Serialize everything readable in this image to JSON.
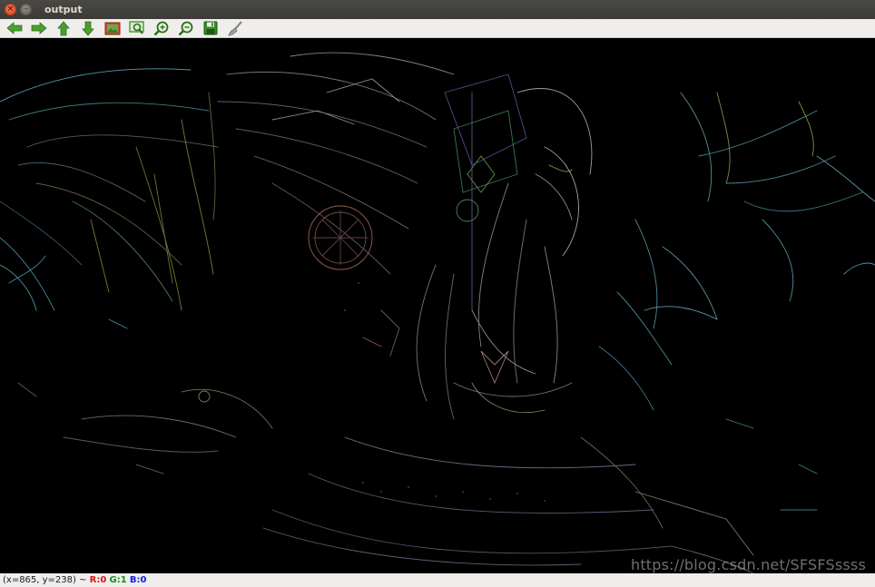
{
  "window": {
    "title": "output",
    "close_glyph": "×",
    "minimize_glyph": "–"
  },
  "toolbar": {
    "buttons": [
      {
        "name": "pan-left-button",
        "icon": "arrow-left-icon",
        "color": "#4aa02c"
      },
      {
        "name": "pan-right-button",
        "icon": "arrow-right-icon",
        "color": "#4aa02c"
      },
      {
        "name": "pan-up-button",
        "icon": "arrow-up-icon",
        "color": "#4aa02c"
      },
      {
        "name": "pan-down-button",
        "icon": "arrow-down-icon",
        "color": "#4aa02c"
      },
      {
        "name": "zoom-reset-button",
        "icon": "image-icon",
        "color": "#c8502a"
      },
      {
        "name": "zoom-fit-button",
        "icon": "zoom-region-icon",
        "color": "#4aa02c"
      },
      {
        "name": "zoom-in-button",
        "icon": "zoom-in-icon",
        "color": "#4aa02c"
      },
      {
        "name": "zoom-out-button",
        "icon": "zoom-out-icon",
        "color": "#4aa02c"
      },
      {
        "name": "save-button",
        "icon": "save-icon",
        "color": "#3a8a2a"
      },
      {
        "name": "properties-button",
        "icon": "brush-icon",
        "color": "#888888"
      }
    ]
  },
  "canvas": {
    "description_icon": "edge-detected-image",
    "watermark": "https://blog.csdn.net/SFSFSssss"
  },
  "status": {
    "coords": "(x=865, y=238) ~ ",
    "r": "R:0",
    "g": "G:1",
    "b": "B:0"
  }
}
